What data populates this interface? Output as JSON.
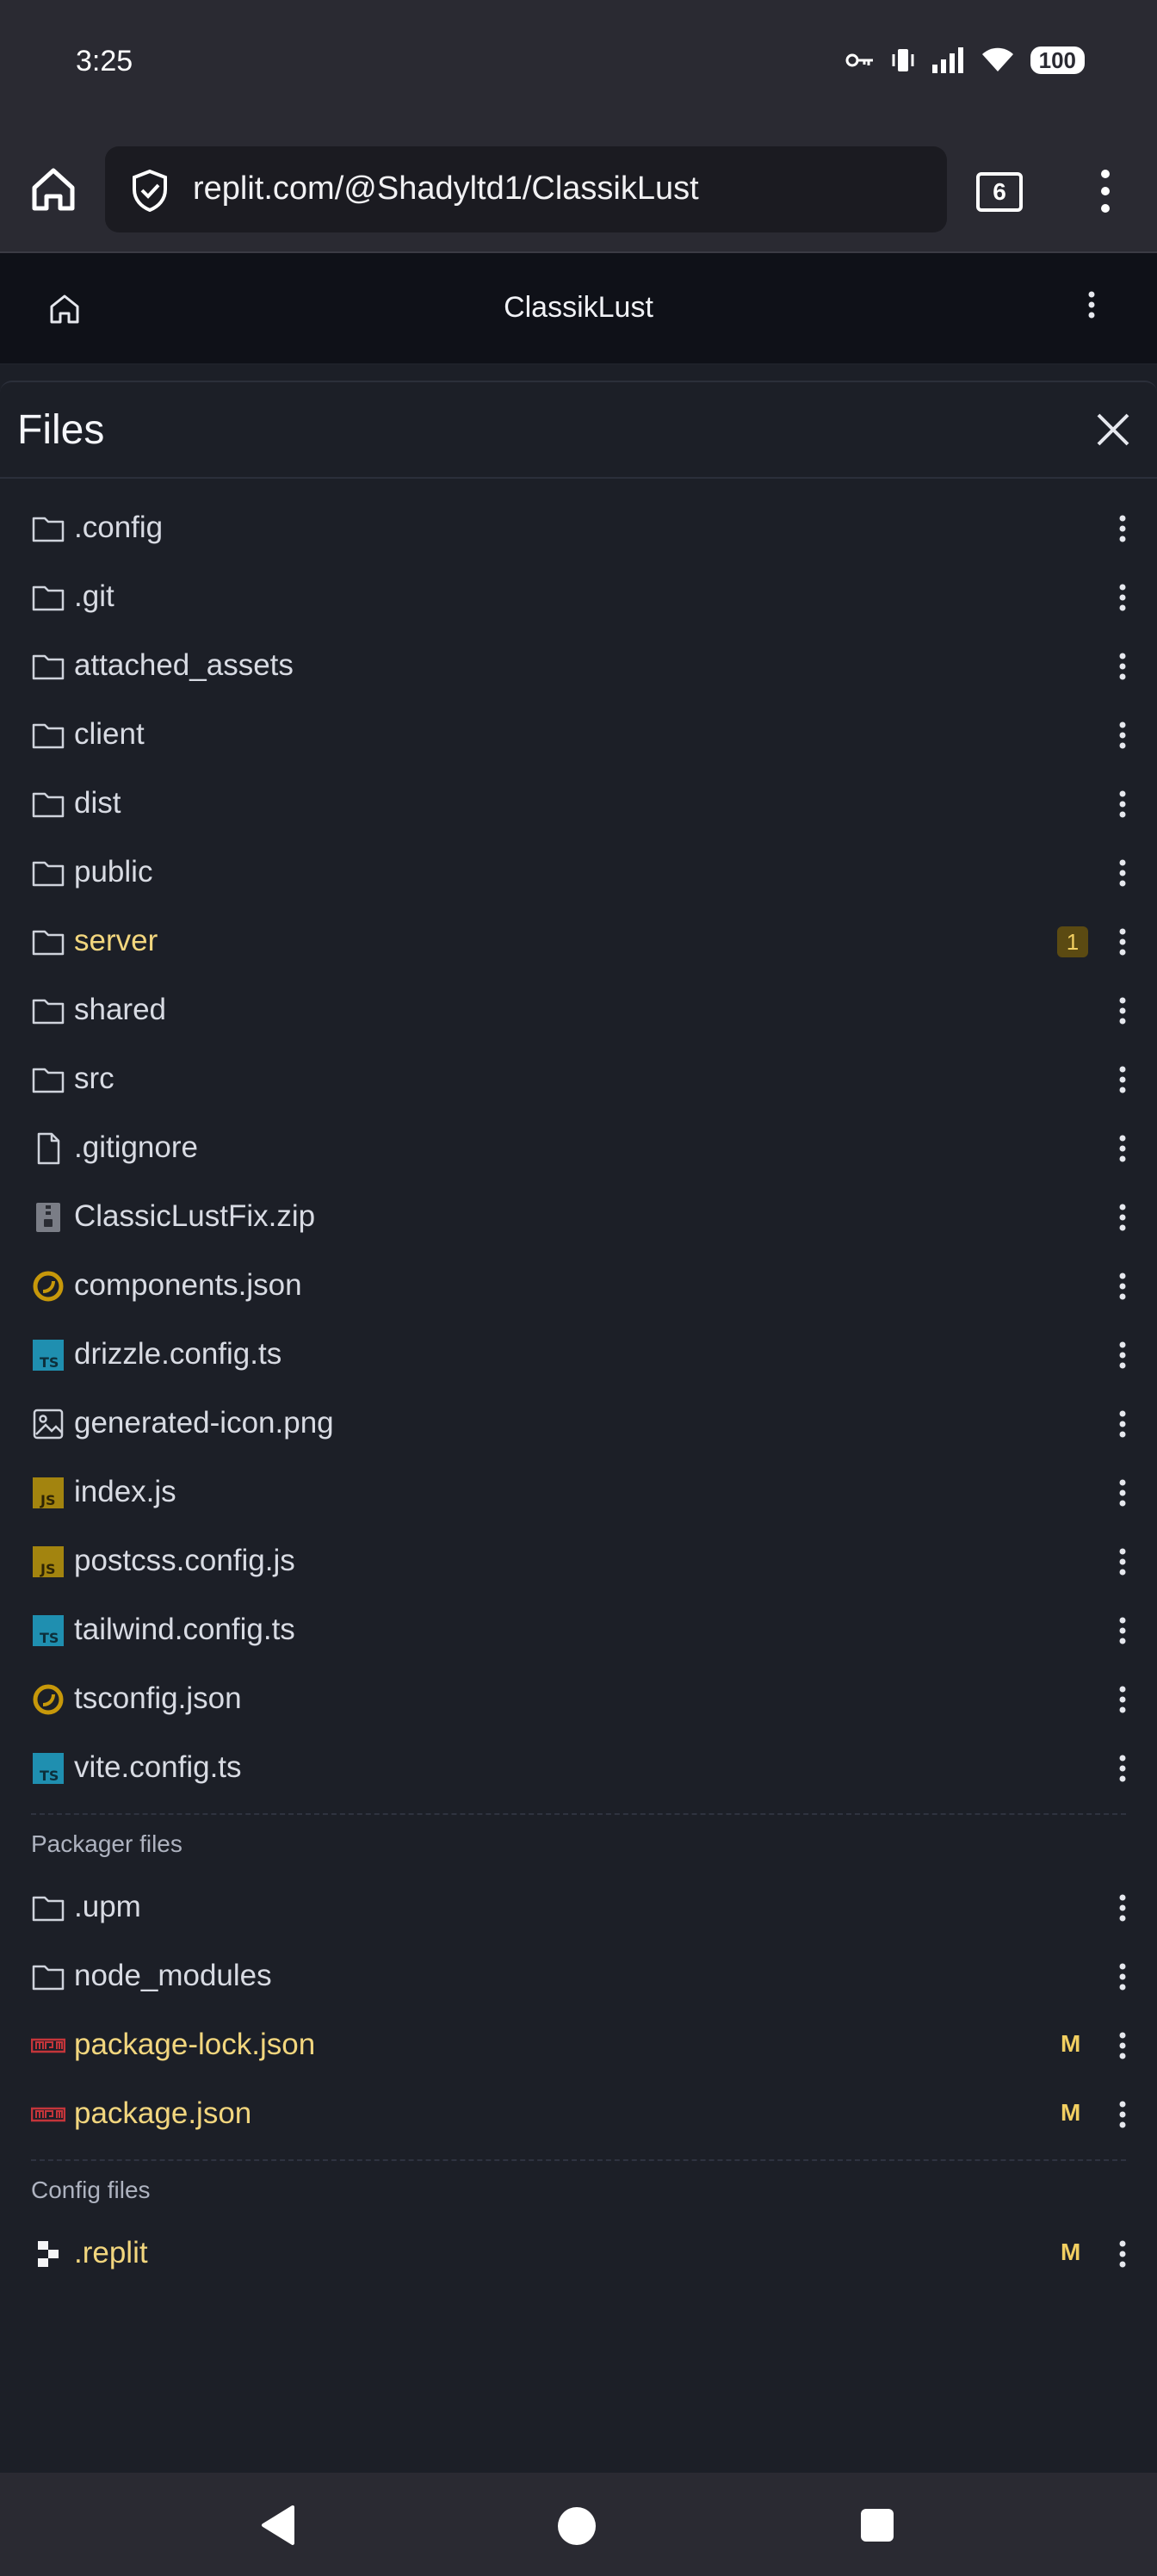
{
  "status_bar": {
    "time": "3:25",
    "battery": "100"
  },
  "browser": {
    "url": "replit.com/@Shadyltd1/ClassikLust",
    "tab_count": "6"
  },
  "replit_header": {
    "title": "ClassikLust"
  },
  "panel": {
    "title": "Files"
  },
  "files": [
    {
      "name": ".config",
      "icon": "folder-icon"
    },
    {
      "name": ".git",
      "icon": "folder-icon"
    },
    {
      "name": "attached_assets",
      "icon": "folder-icon"
    },
    {
      "name": "client",
      "icon": "folder-icon"
    },
    {
      "name": "dist",
      "icon": "folder-icon"
    },
    {
      "name": "public",
      "icon": "folder-icon"
    },
    {
      "name": "server",
      "icon": "folder-icon",
      "badge": "1"
    },
    {
      "name": "shared",
      "icon": "folder-icon"
    },
    {
      "name": "src",
      "icon": "folder-icon"
    },
    {
      "name": ".gitignore",
      "icon": "file-icon"
    },
    {
      "name": "ClassicLustFix.zip",
      "icon": "zip-icon"
    },
    {
      "name": "components.json",
      "icon": "json-icon"
    },
    {
      "name": "drizzle.config.ts",
      "icon": "typescript-icon"
    },
    {
      "name": "generated-icon.png",
      "icon": "image-icon"
    },
    {
      "name": "index.js",
      "icon": "javascript-icon"
    },
    {
      "name": "postcss.config.js",
      "icon": "javascript-icon"
    },
    {
      "name": "tailwind.config.ts",
      "icon": "typescript-icon"
    },
    {
      "name": "tsconfig.json",
      "icon": "json-icon"
    },
    {
      "name": "vite.config.ts",
      "icon": "typescript-icon"
    }
  ],
  "packager_files": {
    "label": "Packager files",
    "items": [
      {
        "name": ".upm",
        "icon": "folder-icon"
      },
      {
        "name": "node_modules",
        "icon": "folder-icon"
      },
      {
        "name": "package-lock.json",
        "icon": "npm-icon",
        "status": "M"
      },
      {
        "name": "package.json",
        "icon": "npm-icon",
        "status": "M"
      }
    ]
  },
  "config_files": {
    "label": "Config files",
    "items": [
      {
        "name": ".replit",
        "icon": "replit-icon",
        "status": "M"
      }
    ]
  },
  "colors": {
    "background": "#1c1f27",
    "modified_text": "#f2d67e",
    "badge": "#f2cf61",
    "typescript": "#1f8fb0",
    "javascript": "#a3840f",
    "json": "#c7980a",
    "npm": "#c4353a"
  }
}
